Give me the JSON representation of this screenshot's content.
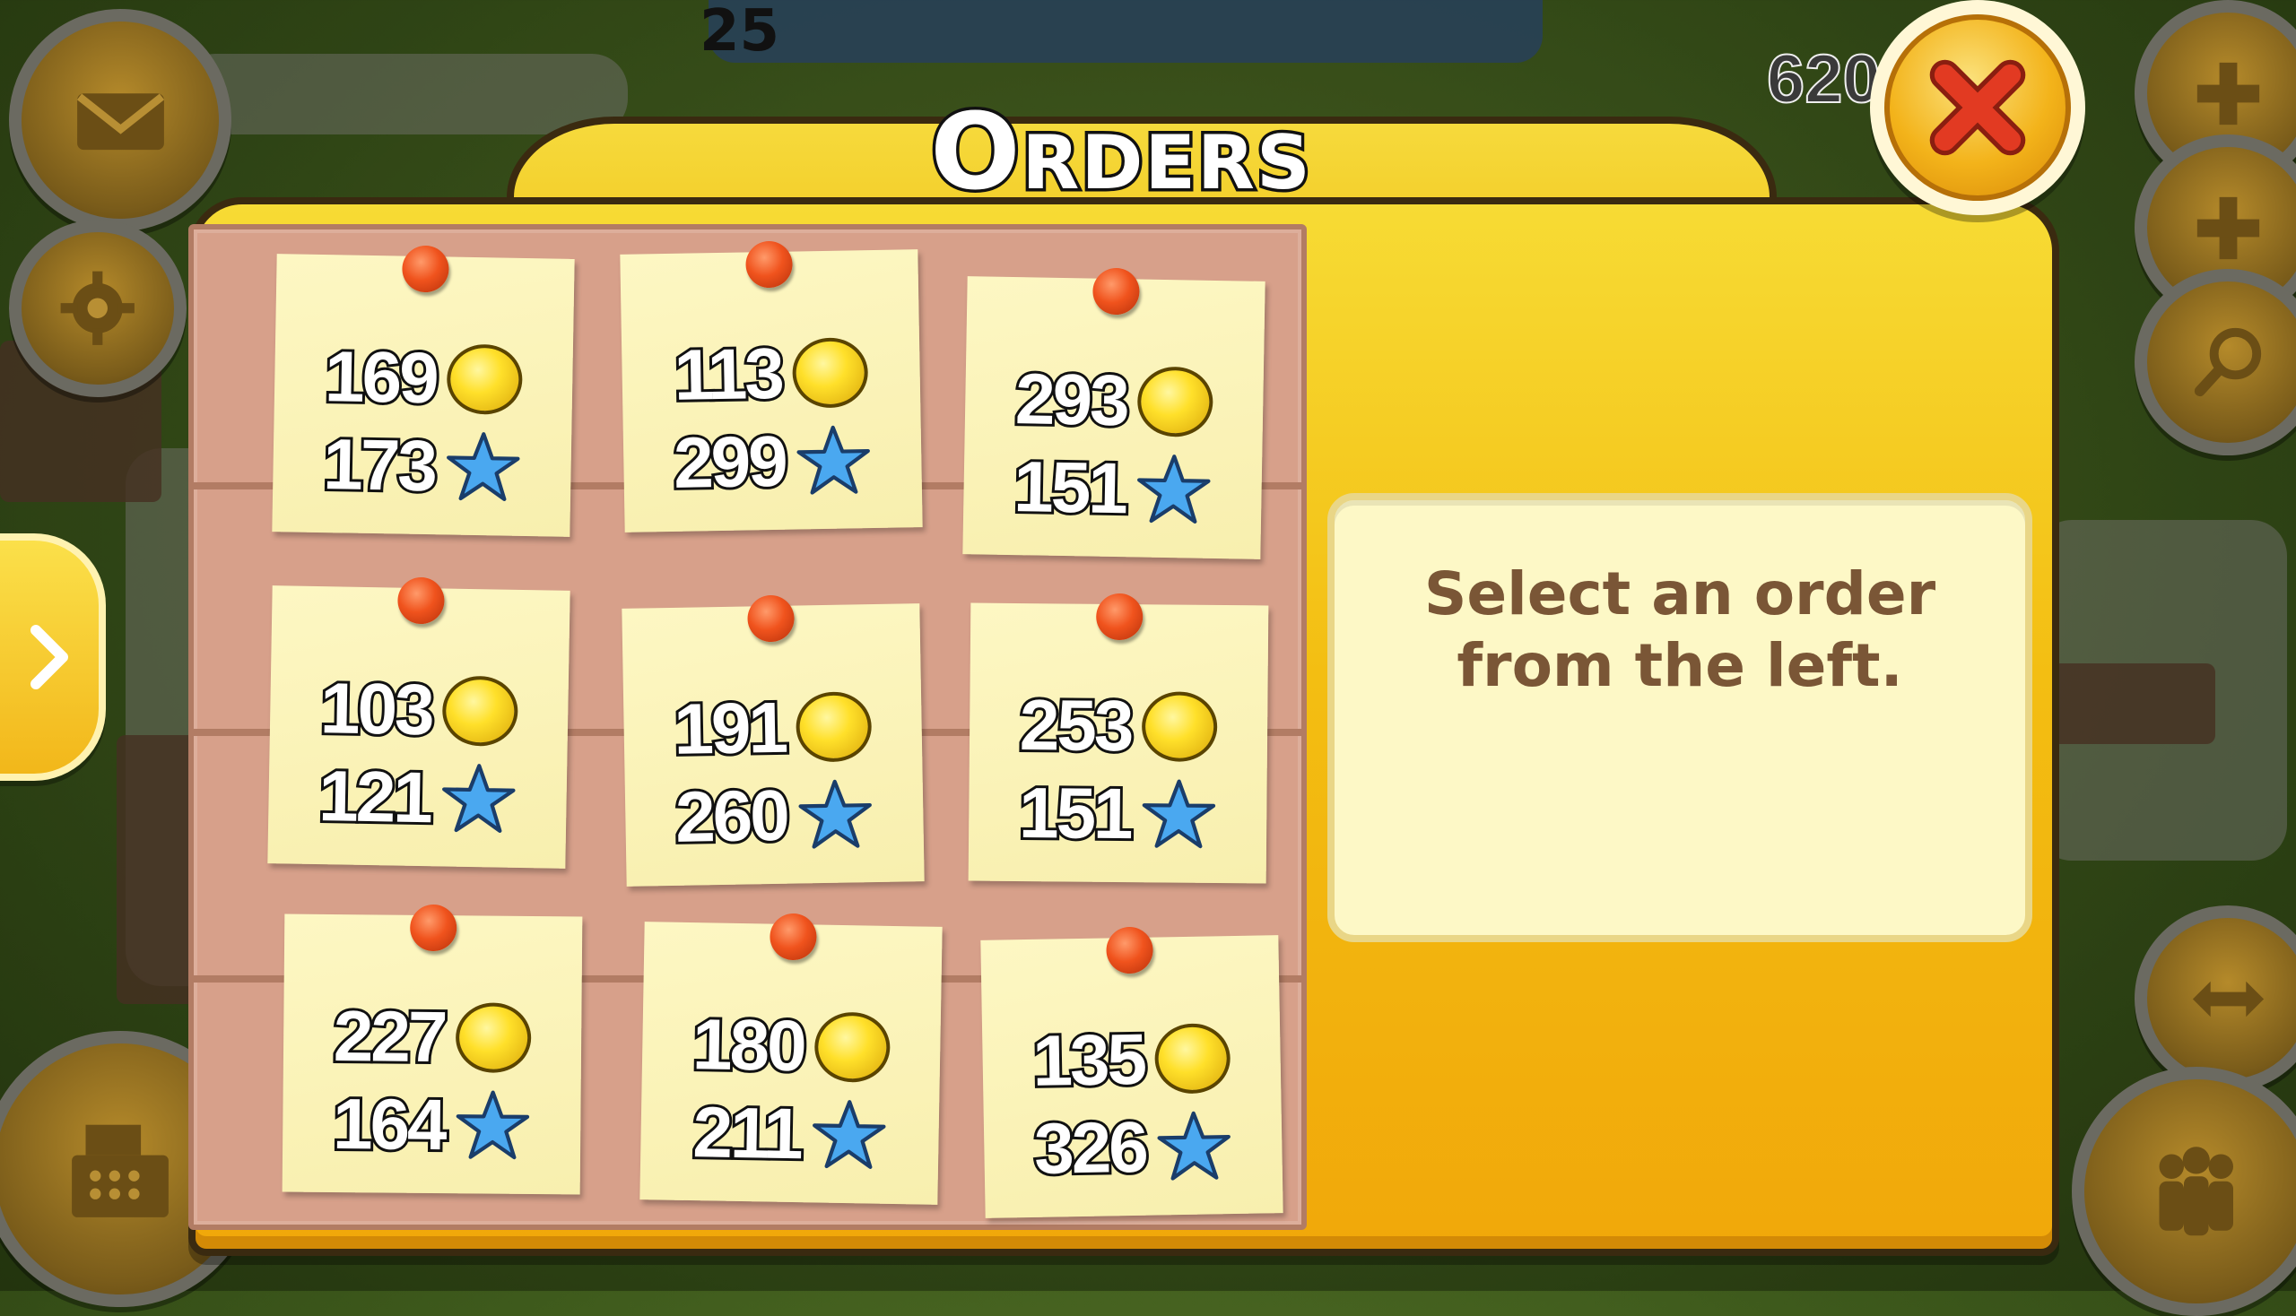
{
  "hud": {
    "level": "25",
    "coins": "620"
  },
  "dialog": {
    "title": "Orders",
    "close_label": "close"
  },
  "orders": [
    {
      "coins": "169",
      "xp": "173"
    },
    {
      "coins": "113",
      "xp": "299"
    },
    {
      "coins": "293",
      "xp": "151"
    },
    {
      "coins": "103",
      "xp": "121"
    },
    {
      "coins": "191",
      "xp": "260"
    },
    {
      "coins": "253",
      "xp": "151"
    },
    {
      "coins": "227",
      "xp": "164"
    },
    {
      "coins": "180",
      "xp": "211"
    },
    {
      "coins": "135",
      "xp": "326"
    }
  ],
  "info_panel": {
    "message": "Select an order\nfrom the left."
  },
  "icons": {
    "coin": "coin-icon",
    "xp": "star-icon",
    "close": "x-icon",
    "mail": "envelope-icon",
    "settings": "gear-icon",
    "add": "plus-icon",
    "search": "magnifier-icon",
    "shop": "cash-register-icon",
    "friends": "people-icon",
    "expand": "arrow-right-icon",
    "edit": "expand-icon"
  },
  "colors": {
    "panel_yellow": "#f3be12",
    "note_paper": "#fdf7c3",
    "board": "#d7a08a",
    "pin": "#f0531d",
    "close_x": "#e23a22",
    "info_text": "#7a5636"
  }
}
